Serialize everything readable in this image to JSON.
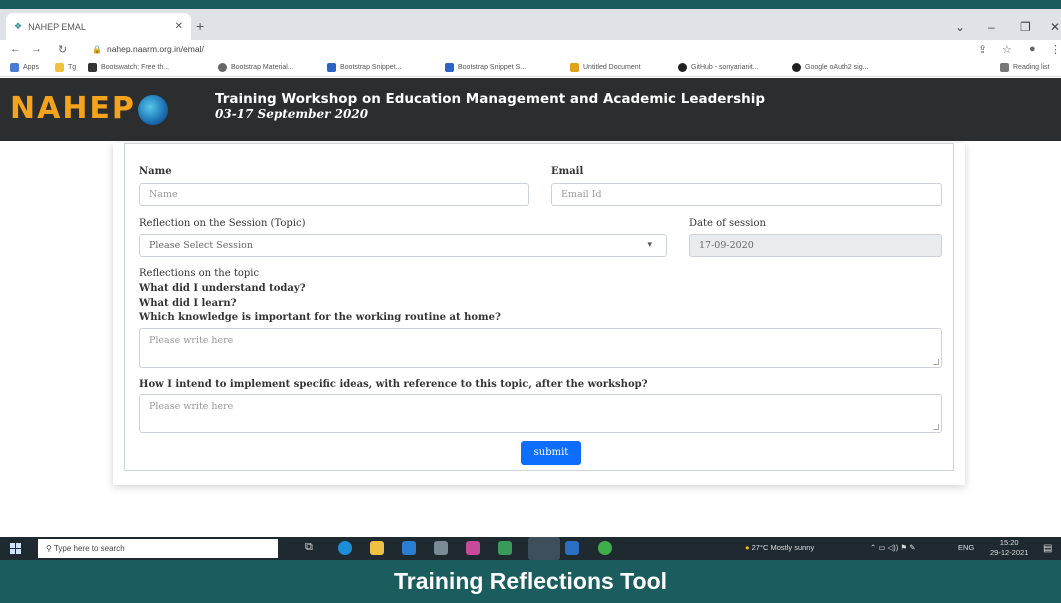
{
  "browser": {
    "tab_title": "NAHEP EMAL",
    "url": "nahep.naarm.org.in/emal/",
    "bookmarks": [
      "Apps",
      "Tg",
      "Bootswatch: Free th...",
      "Bootstrap Material...",
      "Bootstrap Snippet...",
      "Bootstrap Snippet S...",
      "Untitled Document",
      "GitHub - sonyarianit...",
      "Google oAuth2 sig..."
    ],
    "reading_list": "Reading list"
  },
  "header": {
    "logo_text": "NAHEP",
    "title": "Training Workshop on Education Management and Academic Leadership",
    "dates": "03-17 September 2020"
  },
  "form": {
    "name_label": "Name",
    "name_placeholder": "Name",
    "email_label": "Email",
    "email_placeholder": "Email Id",
    "session_label": "Reflection on the Session (Topic)",
    "session_select_value": "Please Select Session",
    "date_label": "Date of session",
    "date_value": "17-09-2020",
    "reflection_heading": "Reflections on the topic",
    "q1": "What did I understand today?",
    "q2": "What did I learn?",
    "q3": "Which knowledge is important for the working routine at home?",
    "reflection_placeholder": "Please write here",
    "implement_label": "How I intend to implement specific ideas, with reference to this topic, after the workshop?",
    "implement_placeholder": "Please write here",
    "submit_label": "submit"
  },
  "taskbar": {
    "search_placeholder": "Type here to search",
    "weather": "27°C  Mostly sunny",
    "lang": "ENG",
    "time": "15:20",
    "date": "29-12-2021"
  },
  "caption": "Training Reflections Tool"
}
